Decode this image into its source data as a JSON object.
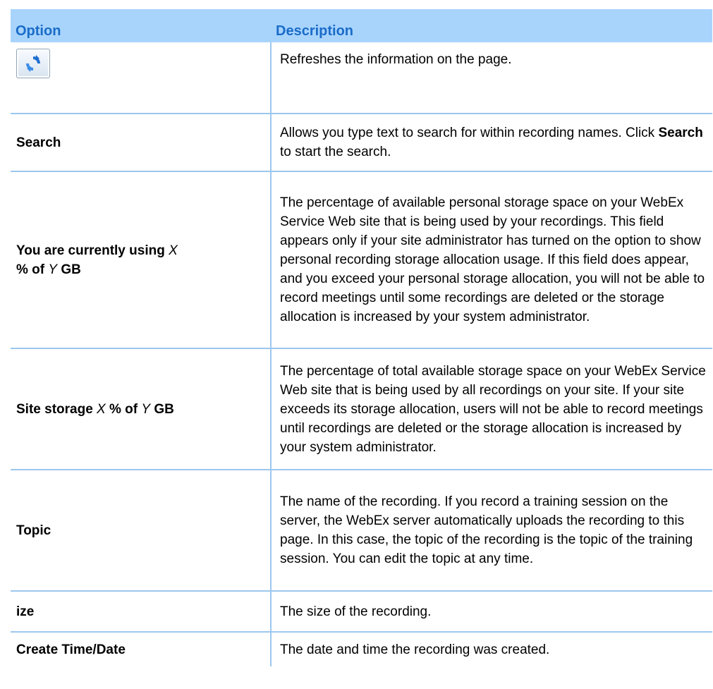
{
  "table": {
    "header": {
      "option": "Option",
      "description": "Description"
    },
    "rows": [
      {
        "option_icon": "refresh-icon",
        "description": "Refreshes the information on the page."
      },
      {
        "option": "Search",
        "description_parts": [
          "Allows you type text to search for within recording names. Click ",
          "Search",
          " to start the search."
        ]
      },
      {
        "option_parts": [
          "You are currently using ",
          "X",
          " % of ",
          "Y",
          " GB"
        ],
        "description": "The percentage of available personal storage space on your WebEx Service Web site that is being used by your recordings. This field appears only if your site administrator has turned on the option to show personal recording storage allocation usage. If this field does appear, and you exceed your personal storage allocation, you will not be able to record meetings until some recordings are deleted or the storage allocation is increased by your system administrator."
      },
      {
        "option_parts": [
          "Site storage ",
          "X",
          " % of ",
          "Y",
          " GB"
        ],
        "description": "The percentage of total available storage space on your WebEx Service Web site that is being used by all recordings on your site. If your site exceeds its storage allocation, users will not be able to record meetings until recordings are deleted or the storage allocation is increased by your system administrator."
      },
      {
        "option": "Topic",
        "description": "The name of the recording. If you record a training session on the server, the WebEx server automatically uploads the recording to this page. In this case, the topic of the recording is the topic of the training session. You can edit the topic at any time."
      },
      {
        "option": "ize",
        "description": "The size of the recording."
      },
      {
        "option": "Create Time/Date",
        "description": "The date and time the recording was created."
      }
    ]
  },
  "colors": {
    "header_bg": "#a8d4fc",
    "header_text": "#1a6cc8",
    "rule": "#9cc7ee"
  }
}
